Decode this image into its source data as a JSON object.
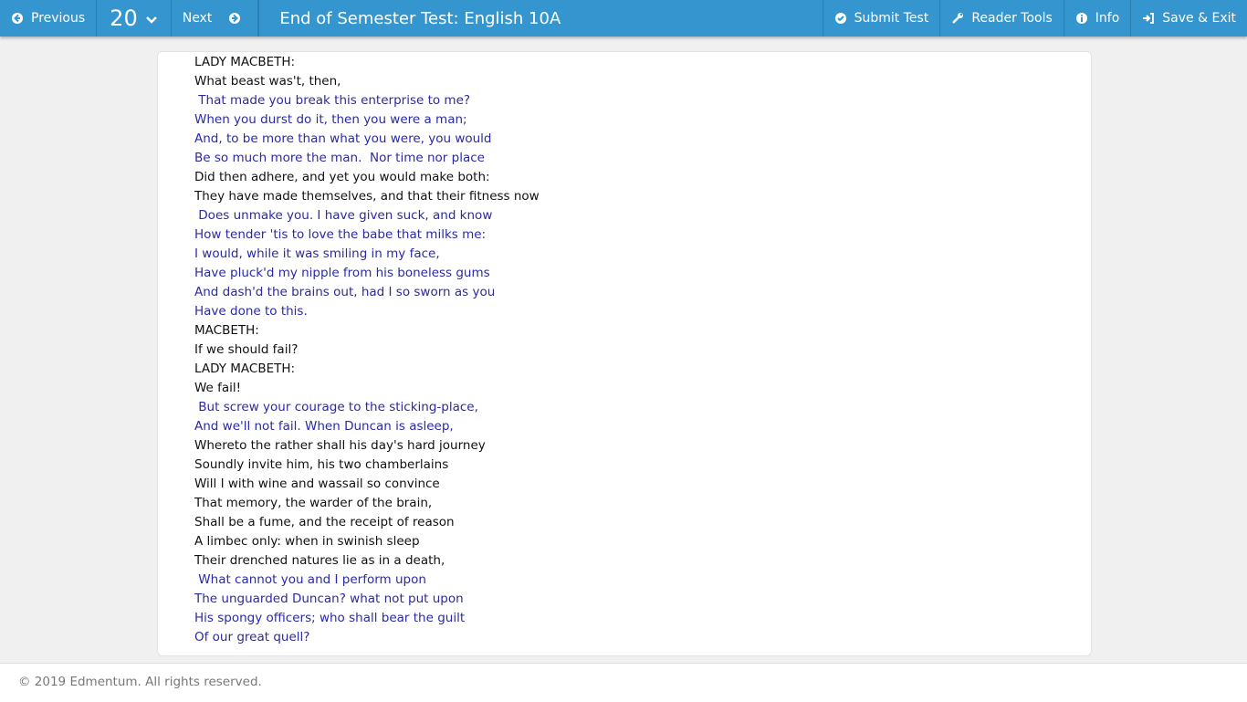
{
  "header": {
    "previous_label": "Previous",
    "question_number": "20",
    "next_label": "Next",
    "title": "End of Semester Test: English 10A",
    "submit_label": "Submit Test",
    "reader_tools_label": "Reader Tools",
    "info_label": "Info",
    "save_exit_label": "Save & Exit"
  },
  "passage": [
    {
      "text": "LADY MACBETH:",
      "hl": false
    },
    {
      "text": "What beast was't, then,",
      "hl": false
    },
    {
      "text": " That made you break this enterprise to me?",
      "hl": true
    },
    {
      "text": "When you durst do it, then you were a man;",
      "hl": true
    },
    {
      "text": "And, to be more than what you were, you would",
      "hl": true
    },
    {
      "text": "Be so much more the man.  Nor time nor place",
      "hl": true
    },
    {
      "text": "Did then adhere, and yet you would make both:",
      "hl": false
    },
    {
      "text": "They have made themselves, and that their fitness now",
      "hl": false
    },
    {
      "text": " Does unmake you. I have given suck, and know",
      "hl": true
    },
    {
      "text": "How tender 'tis to love the babe that milks me:",
      "hl": true
    },
    {
      "text": "I would, while it was smiling in my face,",
      "hl": true
    },
    {
      "text": "Have pluck'd my nipple from his boneless gums",
      "hl": true
    },
    {
      "text": "And dash'd the brains out, had I so sworn as you",
      "hl": true
    },
    {
      "text": "Have done to this.",
      "hl": true
    },
    {
      "text": "MACBETH:",
      "hl": false
    },
    {
      "text": "If we should fail?",
      "hl": false
    },
    {
      "text": "LADY MACBETH:",
      "hl": false
    },
    {
      "text": "We fail!",
      "hl": false
    },
    {
      "text": " But screw your courage to the sticking-place,",
      "hl": true
    },
    {
      "text": "And we'll not fail. When Duncan is asleep,",
      "hl": true
    },
    {
      "text": "Whereto the rather shall his day's hard journey",
      "hl": false
    },
    {
      "text": "Soundly invite him, his two chamberlains",
      "hl": false
    },
    {
      "text": "Will I with wine and wassail so convince",
      "hl": false
    },
    {
      "text": "That memory, the warder of the brain,",
      "hl": false
    },
    {
      "text": "Shall be a fume, and the receipt of reason",
      "hl": false
    },
    {
      "text": "A limbec only: when in swinish sleep",
      "hl": false
    },
    {
      "text": "Their drenched natures lie as in a death,",
      "hl": false
    },
    {
      "text": " What cannot you and I perform upon",
      "hl": true
    },
    {
      "text": "The unguarded Duncan? what not put upon",
      "hl": true
    },
    {
      "text": "His spongy officers; who shall bear the guilt",
      "hl": true
    },
    {
      "text": "Of our great quell?",
      "hl": true
    }
  ],
  "footer": {
    "copyright": "© 2019 Edmentum. All rights reserved."
  },
  "colors": {
    "header": "#3596cf",
    "highlight_text": "#2a2aa6"
  }
}
